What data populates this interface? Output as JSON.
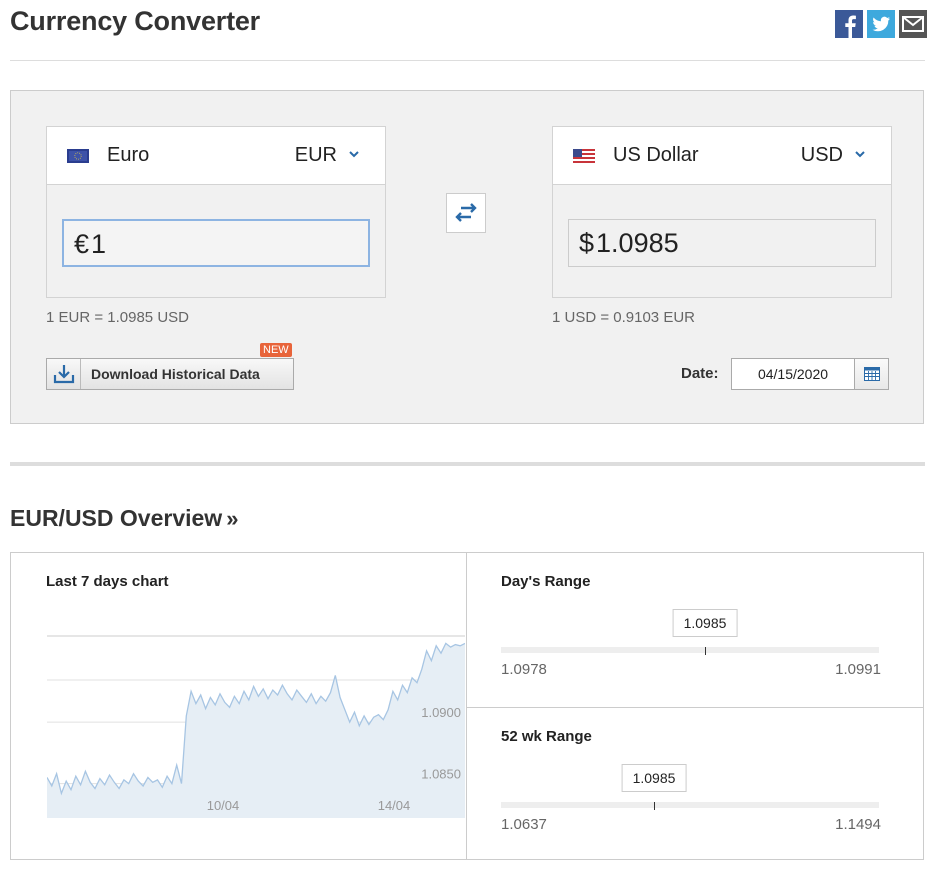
{
  "header": {
    "title": "Currency Converter"
  },
  "converter": {
    "from": {
      "name": "Euro",
      "code": "EUR",
      "symbol": "€",
      "amount": "1",
      "rate_text": "1 EUR = 1.0985 USD"
    },
    "to": {
      "name": "US Dollar",
      "code": "USD",
      "symbol": "$",
      "amount": "1.0985",
      "rate_text": "1 USD = 0.9103 EUR"
    },
    "download_label": "Download Historical Data",
    "new_badge": "NEW",
    "date_label": "Date:",
    "date_value": "04/15/2020"
  },
  "overview": {
    "title": "EUR/USD Overview",
    "title_suffix": "»",
    "chart_title": "Last 7 days chart",
    "days_range": {
      "title": "Day's Range",
      "low": "1.0978",
      "high": "1.0991",
      "current": "1.0985",
      "current_value": 1.0985,
      "low_value": 1.0978,
      "high_value": 1.0991
    },
    "wk52_range": {
      "title": "52 wk Range",
      "low": "1.0637",
      "high": "1.1494",
      "current": "1.0985",
      "current_value": 1.0985,
      "low_value": 1.0637,
      "high_value": 1.1494
    }
  },
  "chart_data": {
    "type": "area",
    "xlabel": "",
    "ylabel": "",
    "x_tick_labels": [
      "10/04",
      "14/04"
    ],
    "y_tick_labels": [
      "1.0900",
      "1.0850"
    ],
    "y_ticks": [
      1.09,
      1.085
    ],
    "ylim": [
      1.0822,
      1.097
    ],
    "grid": true,
    "values": [
      1.0855,
      1.0848,
      1.0858,
      1.0842,
      1.0852,
      1.0845,
      1.0856,
      1.0849,
      1.086,
      1.0851,
      1.0846,
      1.0854,
      1.0849,
      1.0857,
      1.0851,
      1.0846,
      1.0853,
      1.085,
      1.0858,
      1.0852,
      1.0848,
      1.0855,
      1.0851,
      1.0853,
      1.0847,
      1.0856,
      1.085,
      1.0865,
      1.085,
      1.0905,
      1.0925,
      1.0915,
      1.0922,
      1.0911,
      1.092,
      1.0914,
      1.0923,
      1.0916,
      1.0912,
      1.0921,
      1.0915,
      1.0925,
      1.0918,
      1.0929,
      1.0921,
      1.0927,
      1.0919,
      1.0926,
      1.0922,
      1.093,
      1.0923,
      1.0918,
      1.0926,
      1.0921,
      1.0916,
      1.0923,
      1.0915,
      1.0921,
      1.0917,
      1.0924,
      1.0938,
      1.092,
      1.091,
      1.09,
      1.0908,
      1.0897,
      1.0905,
      1.0898,
      1.0904,
      1.0906,
      1.0902,
      1.091,
      1.0925,
      1.0918,
      1.093,
      1.0924,
      1.0936,
      1.0932,
      1.0943,
      1.0958,
      1.095,
      1.0962,
      1.0956,
      1.0964,
      1.0961,
      1.0963,
      1.0962,
      1.0964
    ]
  },
  "colors": {
    "accent": "#2a6aa8",
    "chart_line": "#a7c5e3",
    "chart_fill": "#e6eef5",
    "badge": "#e8643a"
  }
}
